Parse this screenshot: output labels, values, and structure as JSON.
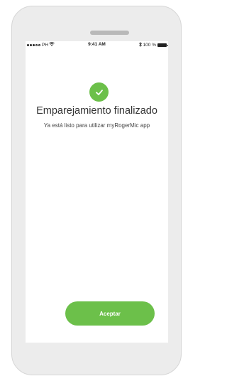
{
  "status_bar": {
    "carrier": "PH",
    "time": "9:41 AM",
    "battery": "100 %",
    "icons": [
      "signal-dots-icon",
      "wifi-icon",
      "bluetooth-icon",
      "battery-icon"
    ]
  },
  "success": {
    "icon": "checkmark-icon",
    "title": "Emparejamiento finalizado",
    "message": "Ya está listo para utilizar myRogerMic app"
  },
  "actions": {
    "accept_label": "Aceptar"
  },
  "colors": {
    "accent": "#6cc04a",
    "device_frame": "#ececec",
    "text": "#333333"
  }
}
